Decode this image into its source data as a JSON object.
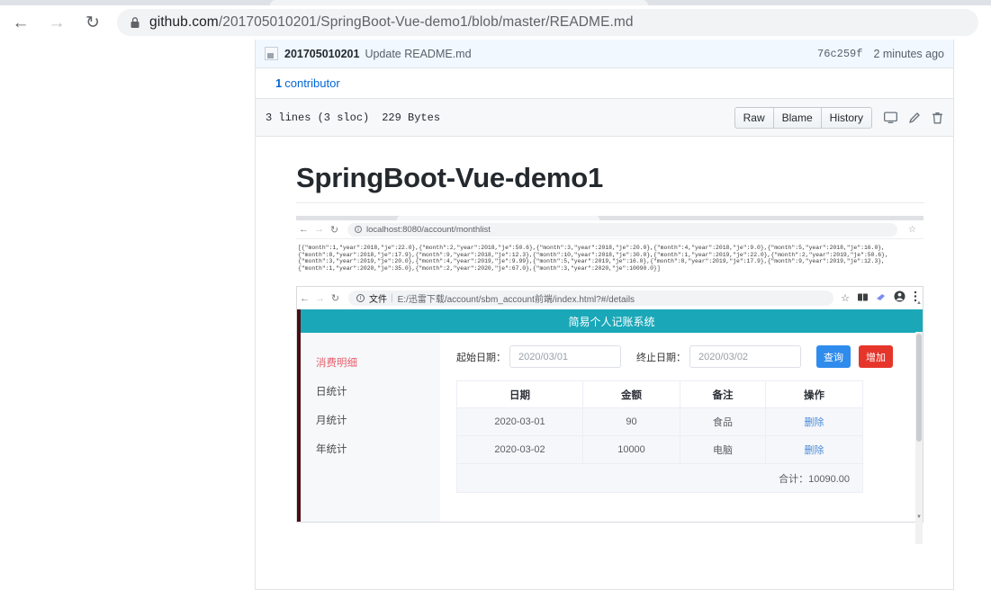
{
  "browser": {
    "back_icon": "back-arrow-icon",
    "forward_icon": "forward-arrow-icon",
    "reload_icon": "reload-icon",
    "lock_icon": "lock-icon",
    "url_host": "github.com",
    "url_path": "/201705010201/SpringBoot-Vue-demo1/blob/master/README.md",
    "url_full": "github.com/201705010201/SpringBoot-Vue-demo1/blob/master/README.md"
  },
  "github": {
    "commit": {
      "author": "201705010201",
      "message": "Update README.md",
      "sha": "76c259f",
      "time": "2 minutes ago"
    },
    "contributors": {
      "count": "1",
      "label": "contributor"
    },
    "blob": {
      "lines": "3 lines (3 sloc)",
      "size": "229 Bytes",
      "buttons": [
        "Raw",
        "Blame",
        "History"
      ],
      "icons": [
        "desktop-icon",
        "pencil-icon",
        "trash-icon"
      ]
    },
    "readme": {
      "heading": "SpringBoot-Vue-demo1"
    }
  },
  "screenshot1": {
    "url": "localhost:8080/account/monthlist",
    "star_icon": "star-icon",
    "json_lines": [
      "[{\"month\":1,\"year\":2018,\"je\":22.0},{\"month\":2,\"year\":2018,\"je\":50.6},{\"month\":3,\"year\":2018,\"je\":20.0},{\"month\":4,\"year\":2018,\"je\":9.0},{\"month\":5,\"year\":2018,\"je\":16.0},",
      "{\"month\":8,\"year\":2018,\"je\":17.9},{\"month\":9,\"year\":2018,\"je\":12.3},{\"month\":10,\"year\":2018,\"je\":30.0},{\"month\":1,\"year\":2019,\"je\":22.0},{\"month\":2,\"year\":2019,\"je\":50.6},",
      "{\"month\":3,\"year\":2019,\"je\":20.0},{\"month\":4,\"year\":2019,\"je\":9.99},{\"month\":5,\"year\":2019,\"je\":16.0},{\"month\":8,\"year\":2019,\"je\":17.9},{\"month\":9,\"year\":2019,\"je\":12.3},",
      "{\"month\":1,\"year\":2020,\"je\":35.0},{\"month\":2,\"year\":2020,\"je\":67.0},{\"month\":3,\"year\":2020,\"je\":10090.0}]"
    ]
  },
  "screenshot2": {
    "url_label": "文件",
    "url_path": "E:/迅雷下载/account/sbm_account前端/index.html?#/details",
    "toolbar_icons": [
      "star-icon",
      "extension-icon",
      "bird-extension-icon",
      "profile-avatar-icon",
      "kebab-menu-icon"
    ],
    "app": {
      "title": "简易个人记账系统",
      "menu": [
        {
          "label": "消费明细",
          "active": true
        },
        {
          "label": "日统计",
          "active": false
        },
        {
          "label": "月统计",
          "active": false
        },
        {
          "label": "年统计",
          "active": false
        }
      ],
      "filters": {
        "start_label": "起始日期：",
        "start_value": "2020/03/01",
        "end_label": "终止日期：",
        "end_value": "2020/03/02",
        "query_button": "查询",
        "add_button": "增加"
      },
      "table": {
        "headers": [
          "日期",
          "金额",
          "备注",
          "操作"
        ],
        "rows": [
          {
            "date": "2020-03-01",
            "amount": "90",
            "note": "食品",
            "action": "删除"
          },
          {
            "date": "2020-03-02",
            "amount": "10000",
            "note": "电脑",
            "action": "删除"
          }
        ],
        "total": "合计：10090.00"
      }
    }
  },
  "colors": {
    "app_header": "#1aa8b8",
    "query_button": "#2f8ced",
    "add_button": "#e6352b",
    "active_menu": "#e4606d",
    "github_link": "#0366d6"
  }
}
